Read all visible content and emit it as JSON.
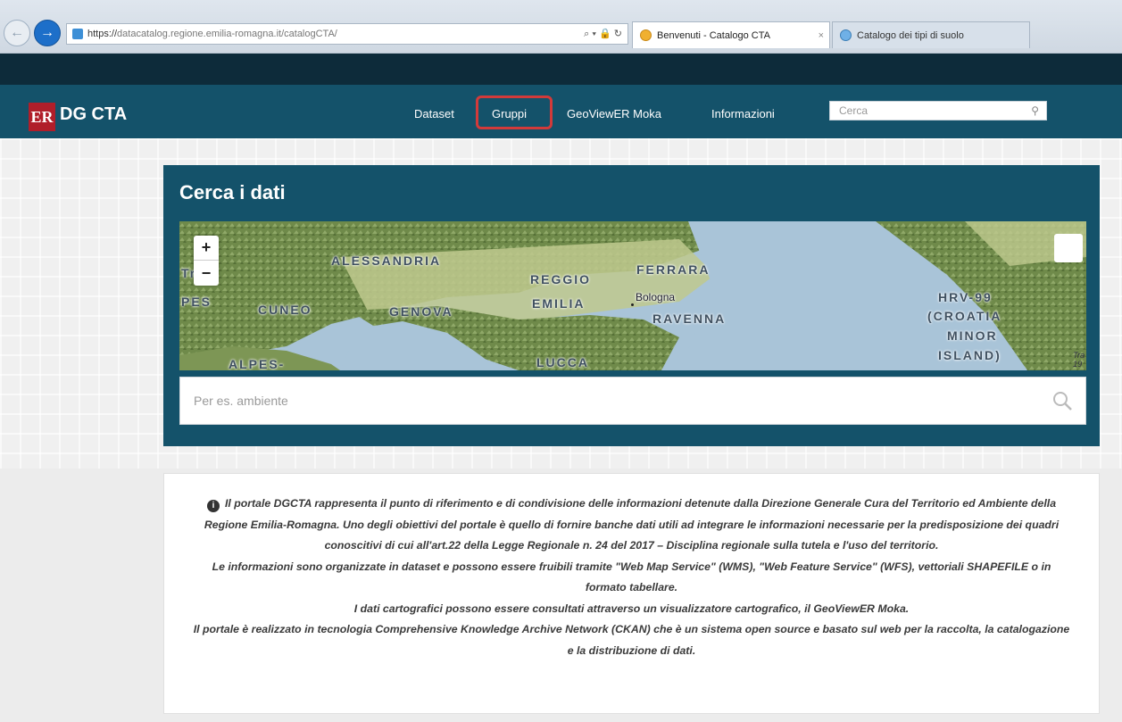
{
  "browser": {
    "url_prefix": "https://",
    "url": "datacatalog.regione.emilia-romagna.it/catalogCTA/",
    "address_tools": "⌕ ▾ 🔒 ↻",
    "tabs": [
      {
        "title": "Benvenuti - Catalogo CTA",
        "close": "×"
      },
      {
        "title": "Catalogo dei tipi di suolo"
      }
    ]
  },
  "header": {
    "logo_mark": "ER",
    "logo_text": "DG CTA",
    "nav": [
      "Dataset",
      "Gruppi",
      "GeoViewER Moka",
      "Informazioni"
    ],
    "search_placeholder": "Cerca"
  },
  "search_panel": {
    "title": "Cerca i dati",
    "zoom_in": "+",
    "zoom_out": "−",
    "map_labels": [
      "ALESSANDRIA",
      "REGGIO",
      "EMILIA",
      "FERRARA",
      "Bologna",
      "RAVENNA",
      "CUNEO",
      "GENOVA",
      "HRV-99",
      "(CROATIA",
      "MINOR",
      "ISLAND)",
      "ALPES-",
      "LUCCA",
      "Tr",
      "PES"
    ],
    "attribution": "Tra\n19",
    "input_placeholder": "Per es. ambiente"
  },
  "info": {
    "icon": "i",
    "paragraphs": [
      "Il portale DGCTA rappresenta il punto di riferimento e di condivisione delle informazioni detenute dalla Direzione Generale Cura del Territorio ed Ambiente della Regione Emilia-Romagna. Uno degli obiettivi del portale è quello di fornire banche dati utili ad integrare le informazioni necessarie per la predisposizione dei quadri conoscitivi di cui all'art.22 della Legge Regionale n. 24 del 2017 – Disciplina regionale sulla tutela e l'uso del territorio.",
      "Le informazioni sono organizzate in dataset e possono essere fruibili tramite \"Web Map Service\" (WMS), \"Web Feature Service\" (WFS), vettoriali SHAPEFILE o in formato tabellare.",
      "I dati cartografici possono essere consultati attraverso un visualizzatore cartografico, il GeoViewER Moka.",
      "Il portale è realizzato in tecnologia Comprehensive Knowledge Archive Network (CKAN) che è un sistema open source e basato sul web per la raccolta, la catalogazione e la distribuzione di dati."
    ]
  },
  "colors": {
    "header_bg": "#14526a",
    "top_strip": "#0d2b3a",
    "logo_red": "#b01e2a",
    "highlight": "#d23a3a"
  }
}
